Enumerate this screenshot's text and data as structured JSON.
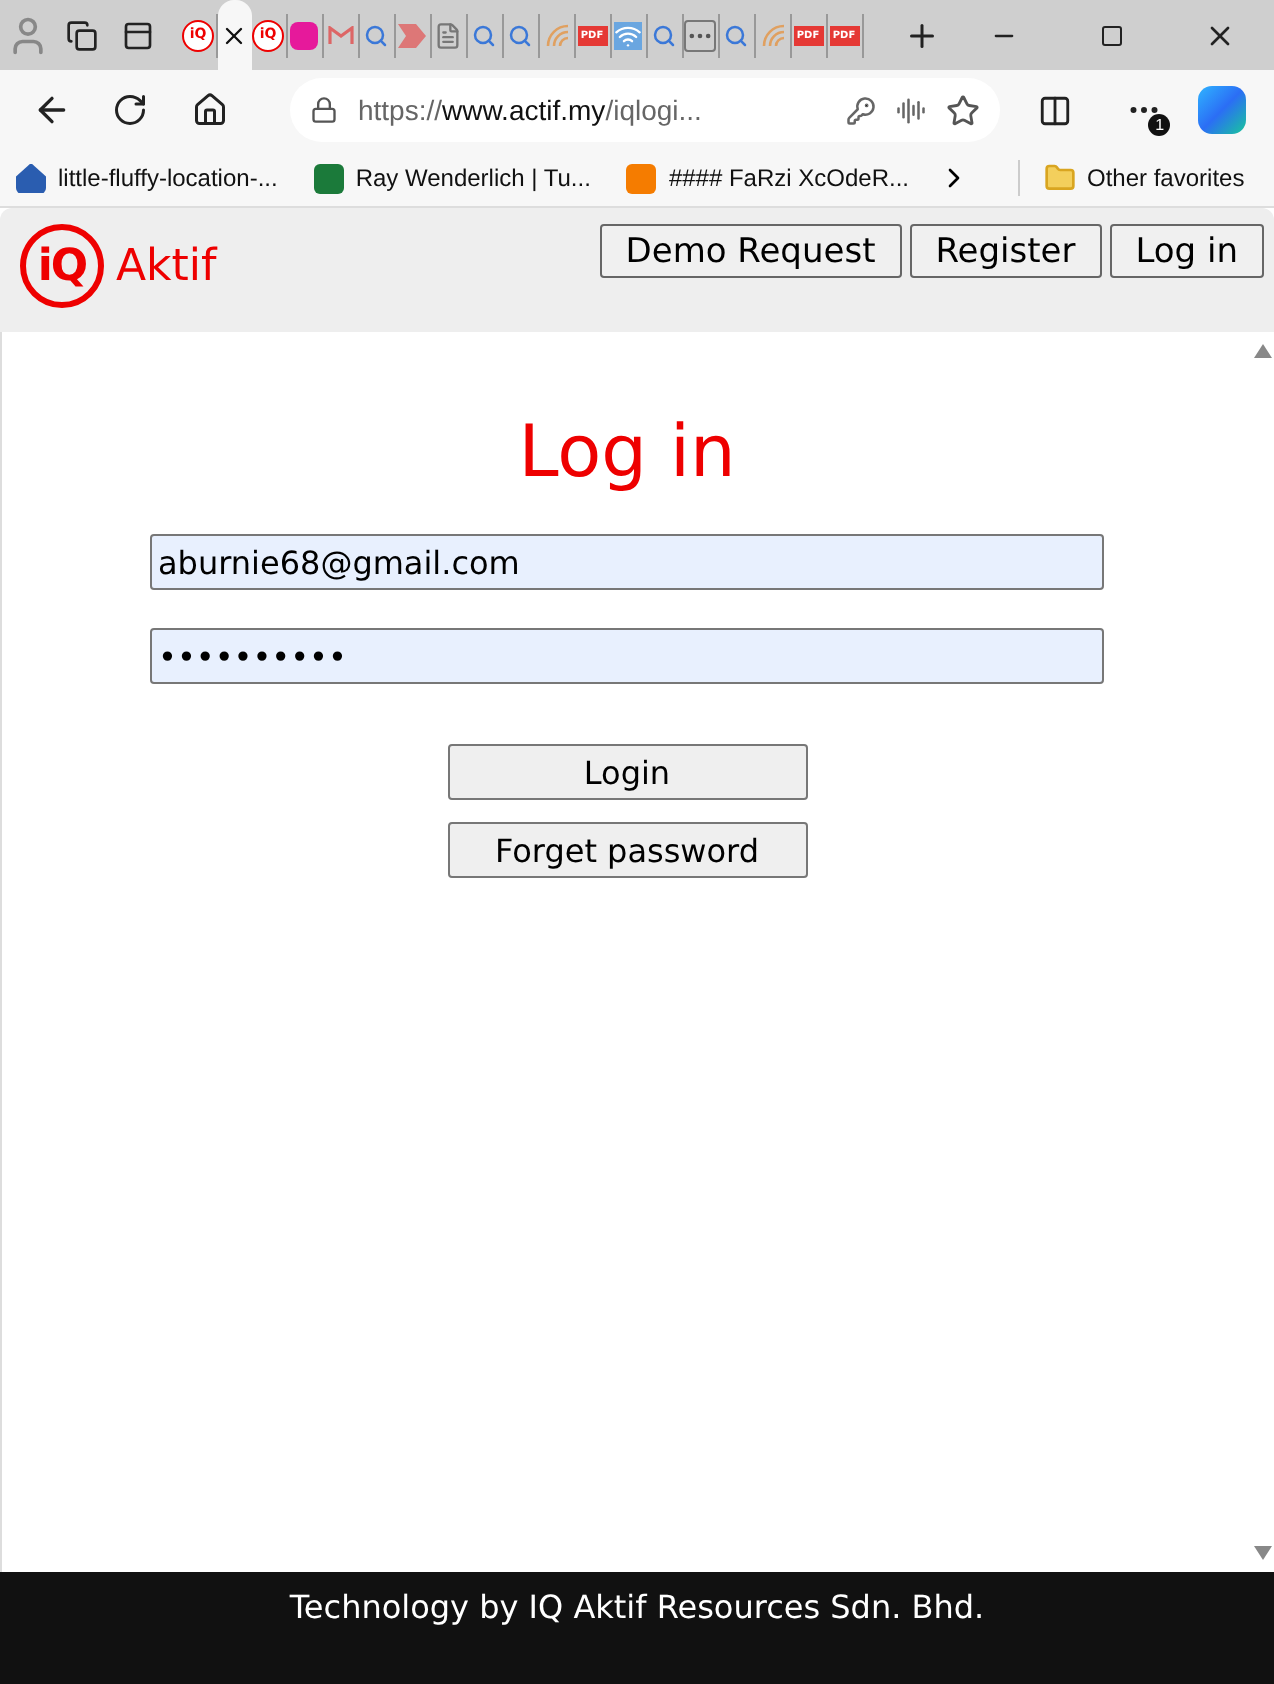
{
  "browser": {
    "tabs": [
      {
        "kind": "iq",
        "label": "iQ",
        "selected": false
      },
      {
        "kind": "blank",
        "selected": true
      },
      {
        "kind": "iq",
        "label": "iQ",
        "selected": false
      },
      {
        "kind": "pinkw",
        "selected": false
      },
      {
        "kind": "mail",
        "selected": false
      },
      {
        "kind": "search",
        "selected": false
      },
      {
        "kind": "arrow",
        "selected": false
      },
      {
        "kind": "doc",
        "selected": false
      },
      {
        "kind": "search",
        "selected": false
      },
      {
        "kind": "search",
        "selected": false
      },
      {
        "kind": "rays",
        "selected": false
      },
      {
        "kind": "pdf",
        "label": "PDF",
        "selected": false
      },
      {
        "kind": "wifi",
        "selected": false
      },
      {
        "kind": "search",
        "selected": false
      },
      {
        "kind": "dots",
        "selected": false
      },
      {
        "kind": "search",
        "selected": false
      },
      {
        "kind": "rays",
        "selected": false
      },
      {
        "kind": "pdf",
        "label": "PDF",
        "selected": false
      },
      {
        "kind": "pdf",
        "label": "PDF",
        "selected": false
      }
    ],
    "url": {
      "scheme": "https://",
      "host": "www.actif.my",
      "path": "/iqlogi..."
    },
    "badge": "1",
    "bookmarks": [
      {
        "kind": "house",
        "label": "little-fluffy-location-..."
      },
      {
        "kind": "rw",
        "label": "Ray Wenderlich | Tu..."
      },
      {
        "kind": "blogger",
        "label": "#### FaRzi XcOdeR..."
      }
    ],
    "other_favorites": "Other favorites"
  },
  "page": {
    "logo": {
      "mark": "iQ",
      "name": "Aktif"
    },
    "nav": [
      "Demo Request",
      "Register",
      "Log in"
    ],
    "title": "Log in",
    "email": {
      "value": "aburnie68@gmail.com"
    },
    "password": {
      "value": "••••••••••"
    },
    "buttons": [
      "Login",
      "Forget password"
    ],
    "footer": "Technology by IQ Aktif Resources Sdn. Bhd."
  }
}
